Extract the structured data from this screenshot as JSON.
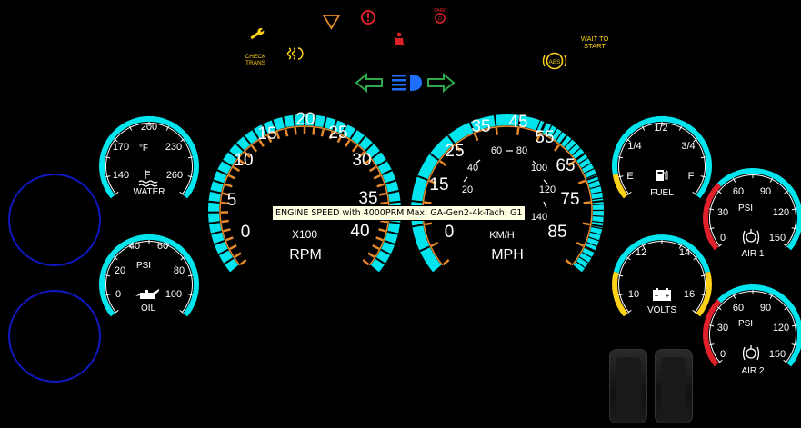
{
  "warning_lights": {
    "check_trans": [
      "CHECK",
      "TRANS"
    ],
    "wait_to_start": [
      "WAIT TO",
      "START"
    ],
    "abs": "ABS",
    "park": "PARK"
  },
  "colors": {
    "cyan": "#00e5ee",
    "orange": "#e8892a",
    "red": "#e0202a",
    "yellow": "#ffd21a",
    "green": "#2ea84a",
    "blue": "#1e6fff",
    "ring_blue": "#1018c0"
  },
  "gauges": {
    "water": {
      "label": "WATER",
      "unit": "°F",
      "ticks": [
        "140",
        "170",
        "200",
        "230",
        "260"
      ]
    },
    "oil": {
      "label": "OIL",
      "unit": "PSI",
      "ticks": [
        "0",
        "20",
        "40",
        "60",
        "80",
        "100"
      ]
    },
    "tach": {
      "label": "RPM",
      "multiplier": "X100",
      "ticks": [
        "0",
        "5",
        "10",
        "15",
        "20",
        "25",
        "30",
        "35",
        "40"
      ]
    },
    "speedo": {
      "label": "MPH",
      "sub_unit": "KM/H",
      "ticks": [
        "0",
        "15",
        "25",
        "35",
        "45",
        "55",
        "65",
        "75",
        "85"
      ],
      "kmh_ticks": [
        "20",
        "40",
        "60",
        "80",
        "100",
        "120",
        "140"
      ]
    },
    "fuel": {
      "label": "FUEL",
      "ticks": [
        "E",
        "1/4",
        "1/2",
        "3/4",
        "F"
      ]
    },
    "volts": {
      "label": "VOLTS",
      "ticks": [
        "10",
        "12",
        "14",
        "16"
      ]
    },
    "air1": {
      "label": "AIR 1",
      "unit": "PSI",
      "ticks": [
        "0",
        "30",
        "60",
        "90",
        "120",
        "150"
      ]
    },
    "air2": {
      "label": "AIR 2",
      "unit": "PSI",
      "ticks": [
        "0",
        "30",
        "60",
        "90",
        "120",
        "150"
      ]
    }
  },
  "tooltip": "ENGINE SPEED with 4000PRM Max: GA-Gen2-4k-Tach: G1"
}
